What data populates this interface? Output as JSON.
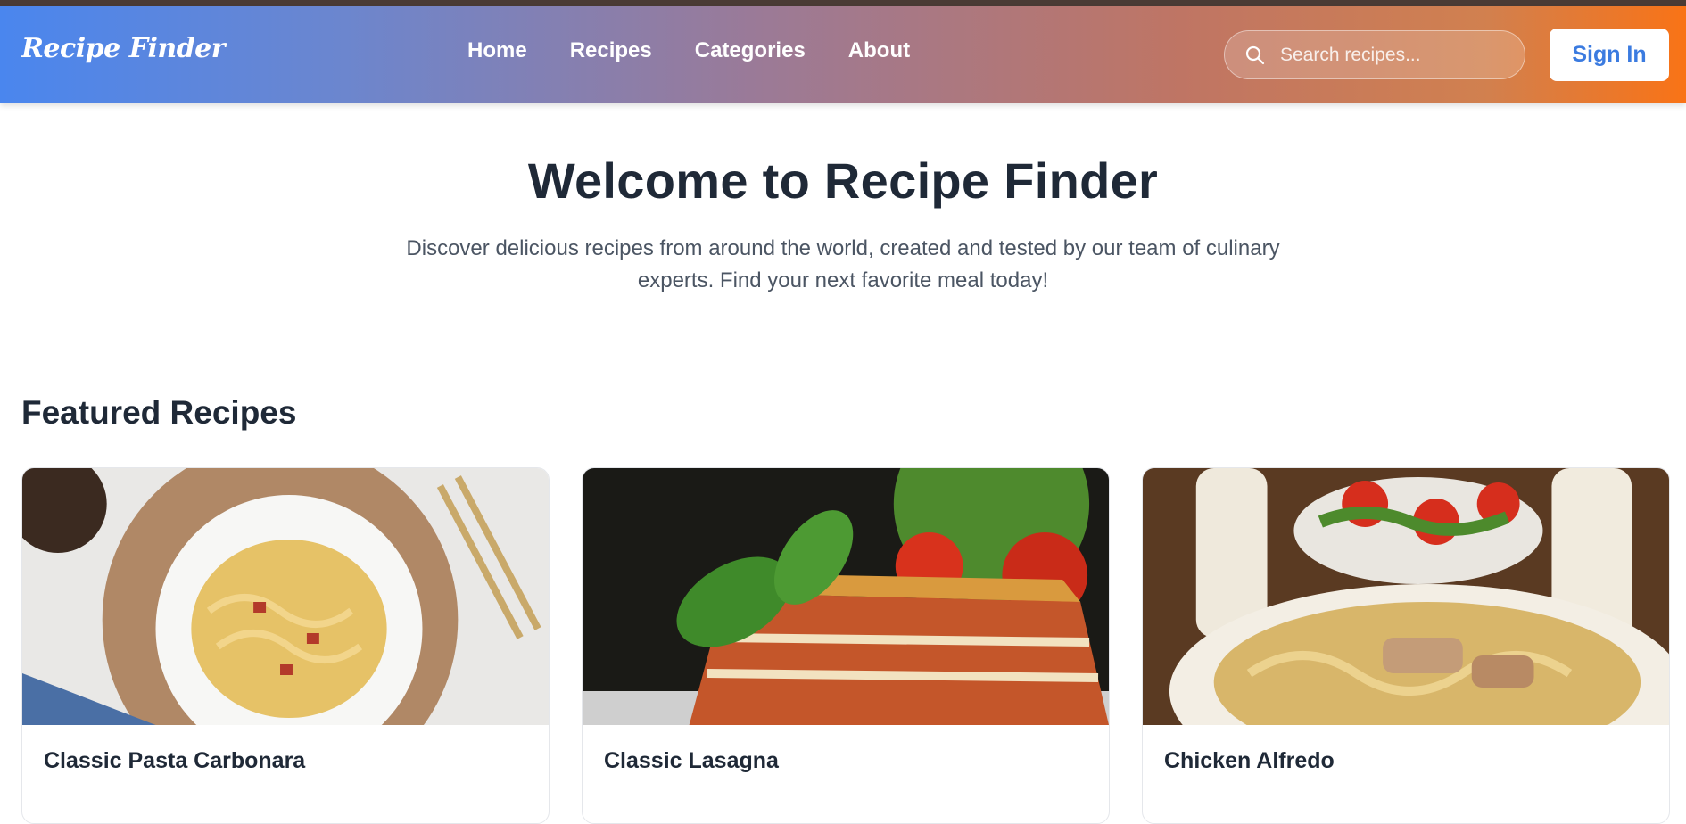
{
  "header": {
    "logo": "Recipe Finder",
    "nav": [
      "Home",
      "Recipes",
      "Categories",
      "About"
    ],
    "search_placeholder": "Search recipes...",
    "sign_in_label": "Sign In"
  },
  "hero": {
    "title": "Welcome to Recipe Finder",
    "subtitle": "Discover delicious recipes from around the world, created and tested by our team of culinary experts. Find your next favorite meal today!"
  },
  "featured": {
    "title": "Featured Recipes",
    "recipes": [
      {
        "title": "Classic Pasta Carbonara"
      },
      {
        "title": "Classic Lasagna"
      },
      {
        "title": "Chicken Alfredo"
      }
    ]
  },
  "colors": {
    "accent_blue": "#3b7be0",
    "accent_orange": "#f97316",
    "text_dark": "#1f2937"
  }
}
